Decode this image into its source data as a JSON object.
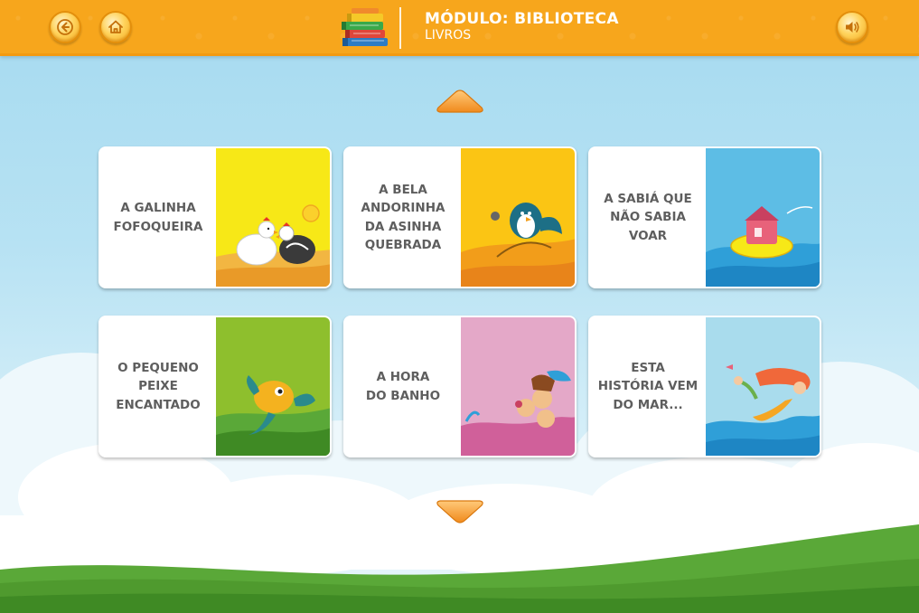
{
  "header": {
    "module_title": "MÓDULO: BIBLIOTECA",
    "module_subtitle": "LIVROS",
    "back_icon": "back-arrow-icon",
    "home_icon": "home-icon",
    "sound_icon": "speaker-icon",
    "module_icon": "books-stack-icon"
  },
  "nav": {
    "up_icon": "arrow-up-icon",
    "down_icon": "arrow-down-icon"
  },
  "books": [
    {
      "title": "A GALINHA\nFOFOQUEIRA",
      "cover_color": "#f7e817"
    },
    {
      "title": "A BELA\nANDORINHA\nDA ASINHA\nQUEBRADA",
      "cover_color": "#fbc514"
    },
    {
      "title": "A SABIÁ QUE\nNÃO SABIA\nVOAR",
      "cover_color": "#5dbde5"
    },
    {
      "title": "O PEQUENO\nPEIXE\nENCANTADO",
      "cover_color": "#8ebf2d"
    },
    {
      "title": "A HORA\nDO BANHO",
      "cover_color": "#e4a8c8"
    },
    {
      "title": "ESTA\nHISTÓRIA VEM\nDO MAR...",
      "cover_color": "#a9dced"
    }
  ],
  "colors": {
    "header": "#f7a61c",
    "button": "#f9c23c",
    "card_text": "#5e5e5e"
  }
}
